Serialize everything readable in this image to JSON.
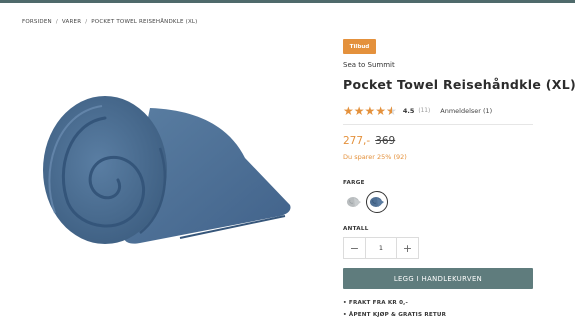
{
  "breadcrumb": [
    "FORSIDEN",
    "VARER",
    "POCKET TOWEL REISEHÅNDKLE (XL)"
  ],
  "breadcrumb_separator": "/",
  "product": {
    "badge": "Tilbud",
    "brand": "Sea to Summit",
    "title": "Pocket Towel Reisehåndkle (XL)",
    "rating": 4.5,
    "rating_label": "4.5",
    "rating_count": "(11)",
    "reviews_link": "Anmeldelser (1)",
    "price_now": "277,-",
    "price_old": "369",
    "savings": "Du sparer 25% (92)",
    "color_label": "FARGE",
    "colors": [
      {
        "name": "grey",
        "swatch": "#b9bdbf"
      },
      {
        "name": "blue",
        "swatch": "#4f6f93"
      }
    ],
    "selected_color": "blue",
    "quantity_label": "ANTALL",
    "quantity": "1",
    "minus": "−",
    "plus": "+",
    "add_to_cart": "LEGG I HANDLEKURVEN",
    "usps": [
      "• FRAKT FRA KR 0,-",
      "• ÅPENT KJØP & GRATIS RETUR"
    ]
  },
  "colors": {
    "accent": "#e4913c",
    "button": "#5f7c7d",
    "topbar": "#4f6a6b",
    "towel": "#4a6c8f"
  },
  "icons": {
    "stars": "star-icon",
    "product_image": "rolled-towel-image"
  }
}
